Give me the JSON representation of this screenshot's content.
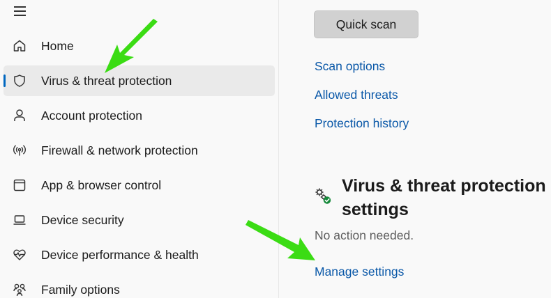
{
  "sidebar": {
    "items": [
      {
        "label": "Home",
        "icon": "home-icon"
      },
      {
        "label": "Virus & threat protection",
        "icon": "shield-icon",
        "selected": true
      },
      {
        "label": "Account protection",
        "icon": "person-icon"
      },
      {
        "label": "Firewall & network protection",
        "icon": "wireless-signal-icon"
      },
      {
        "label": "App & browser control",
        "icon": "browser-window-icon"
      },
      {
        "label": "Device security",
        "icon": "laptop-icon"
      },
      {
        "label": "Device performance & health",
        "icon": "heart-pulse-icon"
      },
      {
        "label": "Family options",
        "icon": "family-icon"
      }
    ]
  },
  "main": {
    "quick_scan_label": "Quick scan",
    "links": [
      "Scan options",
      "Allowed threats",
      "Protection history"
    ],
    "settings_section": {
      "title": "Virus & threat protection settings",
      "status": "No action needed.",
      "manage_link": "Manage settings"
    }
  },
  "colors": {
    "accent": "#0067c0",
    "link": "#0a58a8",
    "annotation_arrow": "#3bdc14"
  }
}
